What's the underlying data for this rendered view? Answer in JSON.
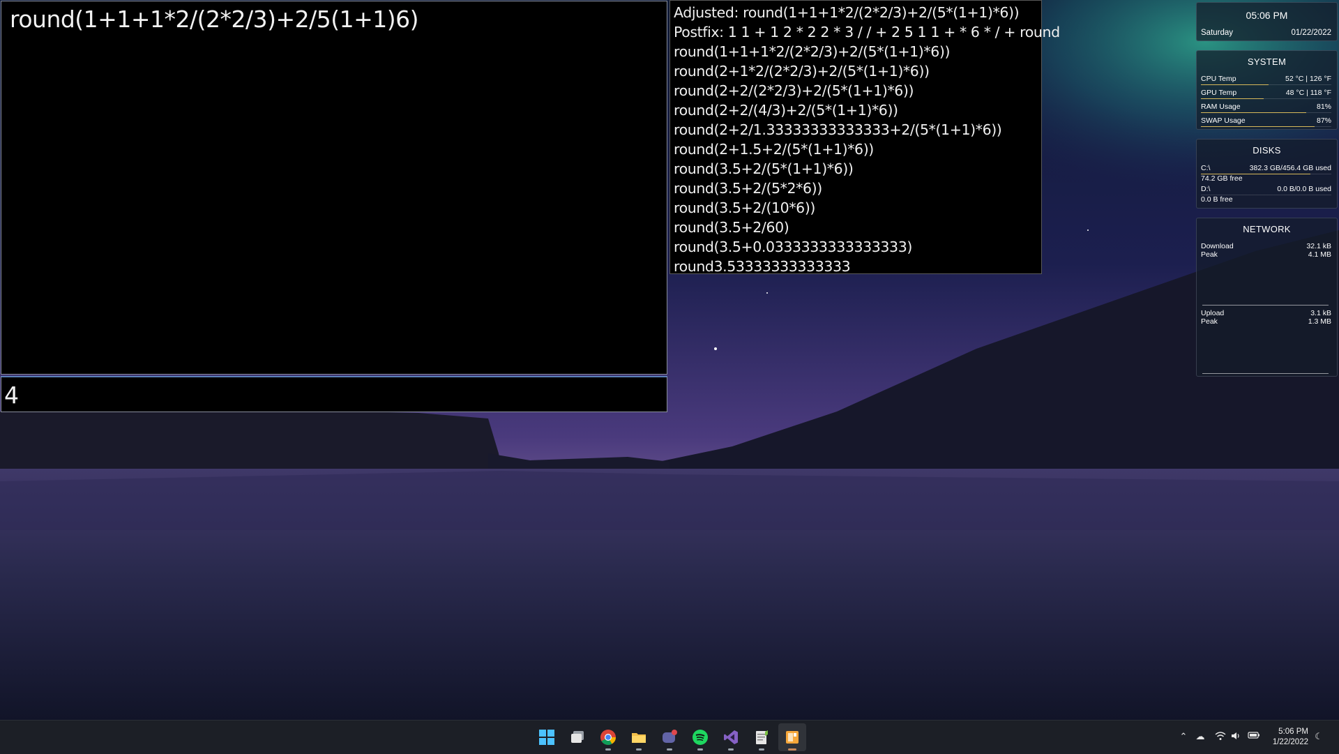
{
  "calculator": {
    "expression": "round(1+1+1*2/(2*2/3)+2/5(1+1)6)",
    "result": "4"
  },
  "steps": [
    "Adjusted: round(1+1+1*2/(2*2/3)+2/(5*(1+1)*6))",
    "Postfix: 1 1 + 1 2 * 2 2 * 3 / / + 2 5 1 1 + * 6 * / + round",
    "round(1+1+1*2/(2*2/3)+2/(5*(1+1)*6))",
    "round(2+1*2/(2*2/3)+2/(5*(1+1)*6))",
    "round(2+2/(2*2/3)+2/(5*(1+1)*6))",
    "round(2+2/(4/3)+2/(5*(1+1)*6))",
    "round(2+2/1.33333333333333+2/(5*(1+1)*6))",
    "round(2+1.5+2/(5*(1+1)*6))",
    "round(3.5+2/(5*(1+1)*6))",
    "round(3.5+2/(5*2*6))",
    "round(3.5+2/(10*6))",
    "round(3.5+2/60)",
    "round(3.5+0.0333333333333333)",
    "round3.53333333333333"
  ],
  "widgets": {
    "clock": {
      "time": "05:06 PM",
      "day": "Saturday",
      "date": "01/22/2022"
    },
    "system": {
      "title": "SYSTEM",
      "rows": [
        {
          "label": "CPU Temp",
          "value": "52 °C | 126 °F",
          "fraction": 0.52
        },
        {
          "label": "GPU Temp",
          "value": "48 °C | 118 °F",
          "fraction": 0.48
        },
        {
          "label": "RAM Usage",
          "value": "81%",
          "fraction": 0.81
        },
        {
          "label": "SWAP Usage",
          "value": "87%",
          "fraction": 0.87
        }
      ]
    },
    "disks": {
      "title": "DISKS",
      "drives": [
        {
          "name": "C:\\",
          "usage": "382.3 GB/456.4 GB used",
          "free": "74.2 GB free",
          "fraction": 0.84
        },
        {
          "name": "D:\\",
          "usage": "0.0 B/0.0 B used",
          "free": "0.0 B free",
          "fraction": 0.0
        }
      ]
    },
    "network": {
      "title": "NETWORK",
      "download_label": "Download",
      "download_value": "32.1 kB",
      "download_peak_label": "Peak",
      "download_peak_value": "4.1 MB",
      "upload_label": "Upload",
      "upload_value": "3.1 kB",
      "upload_peak_label": "Peak",
      "upload_peak_value": "1.3 MB"
    }
  },
  "taskbar": {
    "apps": [
      "start-icon",
      "task-view-icon",
      "chrome-icon",
      "file-explorer-icon",
      "teams-chat-icon",
      "spotify-icon",
      "visual-studio-icon",
      "notepad-icon",
      "calculator-app-icon"
    ],
    "tray_time": "5:06 PM",
    "tray_date": "1/22/2022"
  }
}
